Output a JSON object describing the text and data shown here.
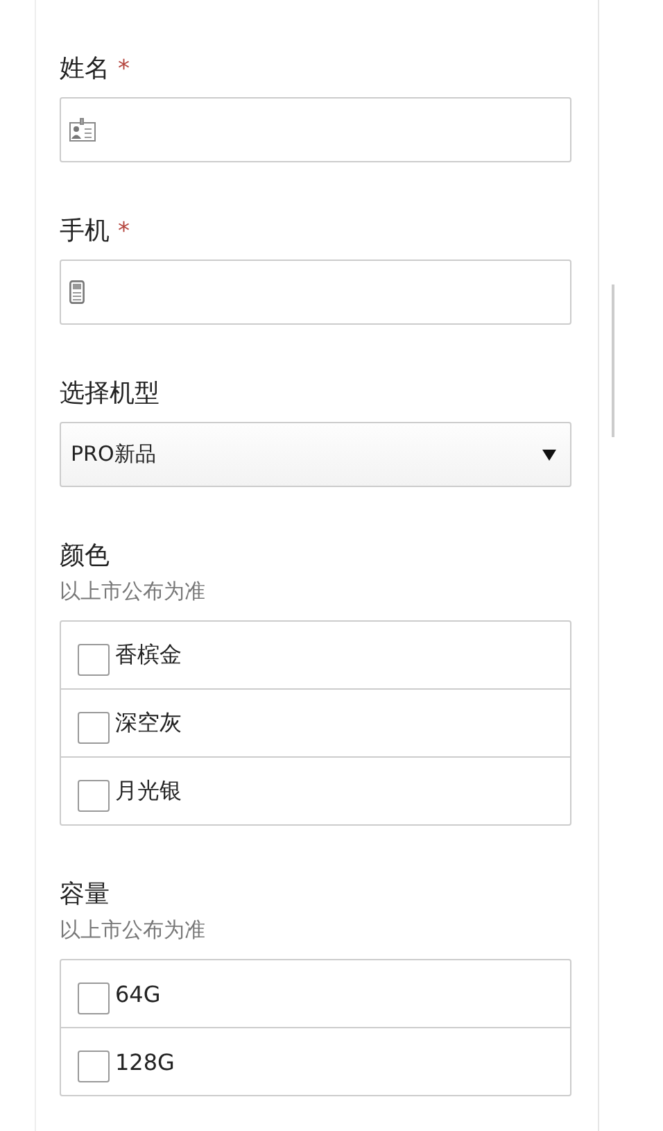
{
  "fields": [
    {
      "kind": "name",
      "label": "姓名",
      "required_mark": "*"
    },
    {
      "kind": "phone",
      "label": "手机",
      "required_mark": "*"
    },
    {
      "kind": "select",
      "label": "选择机型",
      "value": "PRO新品"
    },
    {
      "kind": "checklist",
      "label": "颜色",
      "hint": "以上市公布为准",
      "options": [
        {
          "label": "香槟金",
          "checked": false
        },
        {
          "label": "深空灰",
          "checked": false
        },
        {
          "label": "月光银",
          "checked": false
        }
      ]
    },
    {
      "kind": "checklist",
      "label": "容量",
      "hint": "以上市公布为准",
      "options": [
        {
          "label": "64G",
          "checked": false
        },
        {
          "label": "128G",
          "checked": false
        }
      ]
    }
  ]
}
